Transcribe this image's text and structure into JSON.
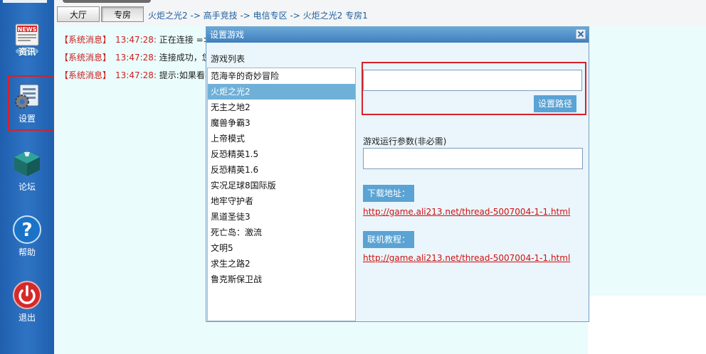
{
  "sidebar": {
    "items": [
      {
        "label": "资讯",
        "icon": "news-icon"
      },
      {
        "label": "设置",
        "icon": "settings-icon"
      },
      {
        "label": "论坛",
        "icon": "forum-icon"
      },
      {
        "label": "帮助",
        "icon": "help-icon"
      },
      {
        "label": "退出",
        "icon": "power-icon"
      }
    ],
    "news_badge": "NEWS"
  },
  "topbar": {
    "tabs": [
      {
        "label": "大厅"
      },
      {
        "label": "专房"
      }
    ],
    "breadcrumb": "火炬之光2 -> 高手竞技 -> 电信专区 -> 火炬之光2 专房1"
  },
  "messages": [
    {
      "tag": "【系统消息】",
      "time": "13:47:28:",
      "text": "正在连接 =>"
    },
    {
      "tag": "【系统消息】",
      "time": "13:47:28:",
      "text": "连接成功，您被"
    },
    {
      "tag": "【系统消息】",
      "time": "13:47:28:",
      "text": "提示:如果看不"
    }
  ],
  "dialog": {
    "title": "设置游戏",
    "list_label": "游戏列表",
    "games": [
      "范海辛的奇妙冒险",
      "火炬之光2",
      "无主之地2",
      "魔兽争霸3",
      "上帝模式",
      "反恐精英1.5",
      "反恐精英1.6",
      "实况足球8国际版",
      "地牢守护者",
      "黑道圣徒3",
      "死亡岛：激流",
      "文明5",
      "求生之路2",
      "鲁克斯保卫战"
    ],
    "selected_game": "火炬之光2",
    "path_value": "",
    "set_path_button": "设置路径",
    "params_label": "游戏运行参数(非必需)",
    "params_value": "",
    "download_label": "下载地址：",
    "download_link": "http://game.ali213.net/thread-5007004-1-1.html",
    "tutorial_label": "联机教程：",
    "tutorial_link": "http://game.ali213.net/thread-5007004-1-1.html"
  },
  "colors": {
    "sidebar_blue": "#2f74c4",
    "highlight_red": "#d8202a",
    "system_msg_red": "#cc2020",
    "dialog_title_blue": "#3f7fbd",
    "button_blue": "#5aa3d4",
    "link_red": "#d01010"
  }
}
